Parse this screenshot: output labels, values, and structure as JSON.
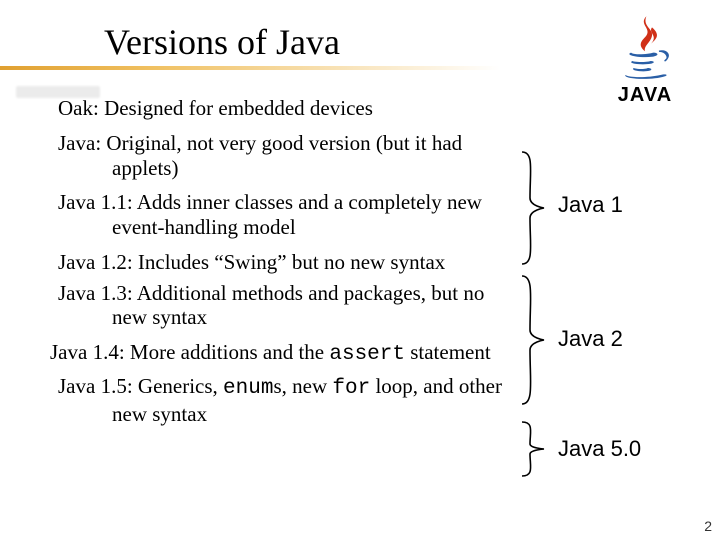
{
  "title": "Versions of Java",
  "logo_text": "JAVA",
  "items": {
    "oak": "Oak: Designed for embedded devices",
    "java0": "Java: Original, not very good version (but it had applets)",
    "j11": "Java 1.1: Adds inner classes and a completely new event-handling model",
    "j12": "Java 1.2: Includes “Swing” but no new syntax",
    "j13": "Java 1.3: Additional methods and packages, but no new syntax",
    "j14_a": "Java 1.4: More additions and the ",
    "j14_assert": "assert",
    "j14_b": " statement",
    "j15_a": "Java 1.5: Generics, ",
    "j15_enum": "enum",
    "j15_b": "s, new ",
    "j15_for": "for",
    "j15_c": " loop, and other new syntax"
  },
  "side_labels": {
    "java1": "Java 1",
    "java2": "Java 2",
    "java5": "Java 5.0"
  },
  "page_number": "2"
}
